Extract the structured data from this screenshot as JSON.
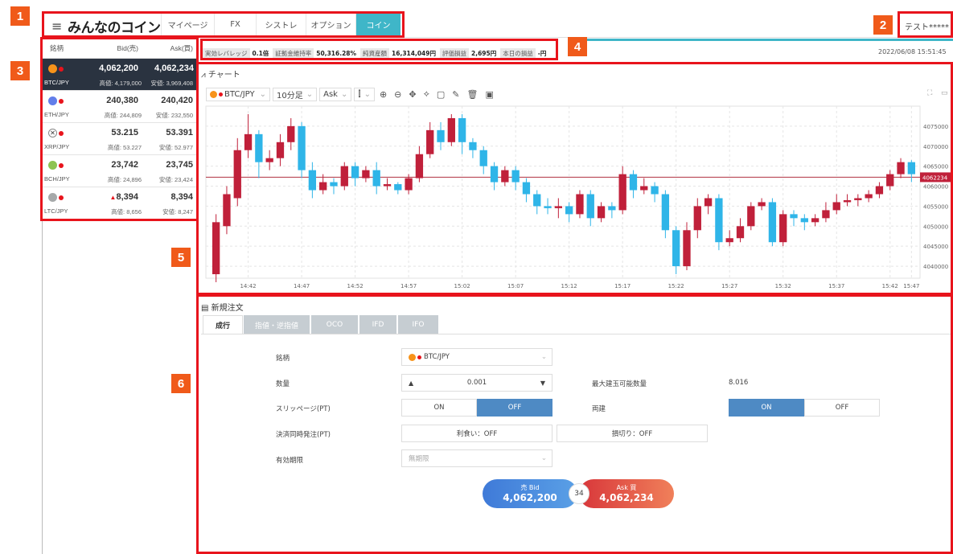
{
  "annotations": {
    "b1": "1",
    "b2": "2",
    "b3": "3",
    "b4": "4",
    "b5": "5",
    "b6": "6"
  },
  "header": {
    "logo": "みんなのコイン",
    "tabs": [
      {
        "label": "マイページ"
      },
      {
        "label": "FX"
      },
      {
        "label": "シストレ"
      },
      {
        "label": "オプション"
      },
      {
        "label": "コイン"
      }
    ],
    "active_tab": "コイン",
    "user": "テスト*****"
  },
  "board": {
    "headers": {
      "symbol": "銘柄",
      "bid": "Bid(売)",
      "ask": "Ask(買)"
    },
    "rows": [
      {
        "symbol": "BTC/JPY",
        "bid": "4,062,200",
        "ask": "4,062,234",
        "high": "高値: 4,179,000",
        "low": "安値: 3,969,408",
        "coin_color": "#f7931a"
      },
      {
        "symbol": "ETH/JPY",
        "bid": "240,380",
        "ask": "240,420",
        "high": "高値: 244,809",
        "low": "安値: 232,550",
        "coin_color": "#627eea"
      },
      {
        "symbol": "XRP/JPY",
        "bid": "53.215",
        "ask": "53.391",
        "high": "高値: 53.227",
        "low": "安値: 52.977",
        "coin_color": "#888888"
      },
      {
        "symbol": "BCH/JPY",
        "bid": "23,742",
        "ask": "23,745",
        "high": "高値: 24,896",
        "low": "安値: 23,424",
        "coin_color": "#8dc351"
      },
      {
        "symbol": "LTC/JPY",
        "bid": "8,394",
        "ask": "8,394",
        "high": "高値: 8,656",
        "low": "安値: 8,247",
        "coin_color": "#a6a9aa",
        "up_mark": "▲"
      }
    ]
  },
  "infobar": {
    "items": [
      {
        "label": "実効レバレッジ",
        "value": "0.1倍"
      },
      {
        "label": "証拠金維持率",
        "value": "50,316.28%"
      },
      {
        "label": "純資産額",
        "value": "16,314,049円"
      },
      {
        "label": "評価損益",
        "value": "2,695円"
      },
      {
        "label": "本日の損益",
        "value": "-円"
      }
    ],
    "timestamp": "2022/06/08 15:51:45"
  },
  "chart": {
    "title": "チャート",
    "symbol": "BTC/JPY",
    "interval": "10分足",
    "side": "Ask",
    "x_labels": [
      "14:42",
      "14:47",
      "14:52",
      "14:57",
      "15:02",
      "15:07",
      "15:12",
      "15:17",
      "15:22",
      "15:27",
      "15:32",
      "15:37",
      "15:42",
      "15:47"
    ],
    "y_labels": [
      "4075000",
      "4070000",
      "4065000",
      "4060000",
      "4055000",
      "4050000",
      "4045000",
      "4040000"
    ],
    "current_price_label": "4062234",
    "up_color": "#c0203a",
    "down_color": "#2fb5e8"
  },
  "chart_data": {
    "type": "candlestick",
    "x_ticks": [
      "14:42",
      "14:47",
      "14:52",
      "14:57",
      "15:02",
      "15:07",
      "15:12",
      "15:17",
      "15:22",
      "15:27",
      "15:32",
      "15:37",
      "15:42",
      "15:47"
    ],
    "y_ticks": [
      4040000,
      4045000,
      4050000,
      4055000,
      4060000,
      4065000,
      4070000,
      4075000
    ],
    "ylim": [
      4037000,
      4080000
    ],
    "current_price": 4062234,
    "candles": [
      [
        4038000,
        4051000,
        4036000,
        4053000
      ],
      [
        4050000,
        4058000,
        4048000,
        4060000
      ],
      [
        4057000,
        4069000,
        4055000,
        4072000
      ],
      [
        4069000,
        4073000,
        4067000,
        4078000
      ],
      [
        4073000,
        4066000,
        4062000,
        4074000
      ],
      [
        4066000,
        4067000,
        4064000,
        4069000
      ],
      [
        4067000,
        4071000,
        4065000,
        4073000
      ],
      [
        4071000,
        4075000,
        4069000,
        4077000
      ],
      [
        4075000,
        4064000,
        4062000,
        4076000
      ],
      [
        4064000,
        4059000,
        4057000,
        4066000
      ],
      [
        4059000,
        4061000,
        4058000,
        4063000
      ],
      [
        4061000,
        4060000,
        4058000,
        4062000
      ],
      [
        4060000,
        4065000,
        4059000,
        4066000
      ],
      [
        4065000,
        4062000,
        4060000,
        4066000
      ],
      [
        4062000,
        4064000,
        4061000,
        4065000
      ],
      [
        4064000,
        4060000,
        4058000,
        4066000
      ],
      [
        4060000,
        4060500,
        4059000,
        4062000
      ],
      [
        4060500,
        4059000,
        4058000,
        4061000
      ],
      [
        4059000,
        4062000,
        4058000,
        4063000
      ],
      [
        4062000,
        4068000,
        4061000,
        4070000
      ],
      [
        4068000,
        4074000,
        4067000,
        4076000
      ],
      [
        4074000,
        4071000,
        4069000,
        4076000
      ],
      [
        4071000,
        4077000,
        4070000,
        4078000
      ],
      [
        4077000,
        4071000,
        4068000,
        4078000
      ],
      [
        4071000,
        4069000,
        4067000,
        4072000
      ],
      [
        4069000,
        4065000,
        4063000,
        4070000
      ],
      [
        4065000,
        4061000,
        4059000,
        4066000
      ],
      [
        4061000,
        4064000,
        4060000,
        4065000
      ],
      [
        4064000,
        4061000,
        4059000,
        4065000
      ],
      [
        4061000,
        4058000,
        4056000,
        4062000
      ],
      [
        4058000,
        4055000,
        4053000,
        4059000
      ],
      [
        4055000,
        4054500,
        4053000,
        4057000
      ],
      [
        4054500,
        4055000,
        4052000,
        4057000
      ],
      [
        4055000,
        4053000,
        4051000,
        4056000
      ],
      [
        4053000,
        4058000,
        4052000,
        4059000
      ],
      [
        4058000,
        4052000,
        4050000,
        4059000
      ],
      [
        4052000,
        4055000,
        4051000,
        4056000
      ],
      [
        4055000,
        4054000,
        4052000,
        4056000
      ],
      [
        4054000,
        4063000,
        4053000,
        4065000
      ],
      [
        4063000,
        4059000,
        4057000,
        4064000
      ],
      [
        4059000,
        4060000,
        4058000,
        4062000
      ],
      [
        4060000,
        4058000,
        4056000,
        4061000
      ],
      [
        4058000,
        4049000,
        4047000,
        4059000
      ],
      [
        4049000,
        4040000,
        4038000,
        4050000
      ],
      [
        4040000,
        4049000,
        4039000,
        4051000
      ],
      [
        4049000,
        4055000,
        4047000,
        4057000
      ],
      [
        4055000,
        4057000,
        4053000,
        4058000
      ],
      [
        4057000,
        4046000,
        4044000,
        4058000
      ],
      [
        4046000,
        4047000,
        4045000,
        4049000
      ],
      [
        4047000,
        4050000,
        4046000,
        4052000
      ],
      [
        4050000,
        4055000,
        4049000,
        4056000
      ],
      [
        4055000,
        4056000,
        4054000,
        4057000
      ],
      [
        4056000,
        4046000,
        4045000,
        4057000
      ],
      [
        4046000,
        4053000,
        4045000,
        4054000
      ],
      [
        4053000,
        4052000,
        4050000,
        4054000
      ],
      [
        4052000,
        4051000,
        4049000,
        4053000
      ],
      [
        4051000,
        4052000,
        4050000,
        4053000
      ],
      [
        4052000,
        4054000,
        4051000,
        4056000
      ],
      [
        4054000,
        4056000,
        4053000,
        4058000
      ],
      [
        4056000,
        4056500,
        4055000,
        4058000
      ],
      [
        4056500,
        4057000,
        4055000,
        4058000
      ],
      [
        4057000,
        4058000,
        4056000,
        4059000
      ],
      [
        4058000,
        4060000,
        4057000,
        4061000
      ],
      [
        4060000,
        4063000,
        4059000,
        4064000
      ],
      [
        4063000,
        4066000,
        4062000,
        4067000
      ],
      [
        4066000,
        4063000,
        4061000,
        4066500
      ]
    ]
  },
  "order": {
    "title": "新規注文",
    "tabs": [
      {
        "label": "成行"
      },
      {
        "label": "指値・逆指値"
      },
      {
        "label": "OCO"
      },
      {
        "label": "IFD"
      },
      {
        "label": "IFO"
      }
    ],
    "symbol_label": "銘柄",
    "symbol_value": "BTC/JPY",
    "qty_label": "数量",
    "qty_value": "0.001",
    "max_qty_label": "最大建玉可能数量",
    "max_qty_value": "8.016",
    "slippage_label": "スリッページ(PT)",
    "slippage_on": "ON",
    "slippage_off": "OFF",
    "both_label": "両建",
    "both_on": "ON",
    "both_off": "OFF",
    "settle_label": "決済同時発注(PT)",
    "take_profit": "利食い：OFF",
    "stop_loss": "損切り：OFF",
    "expiry_label": "有効期限",
    "expiry_value": "無期限",
    "sell_label": "売 Bid",
    "sell_value": "4,062,200",
    "buy_label": "Ask 買",
    "buy_value": "4,062,234",
    "spread": "34"
  }
}
